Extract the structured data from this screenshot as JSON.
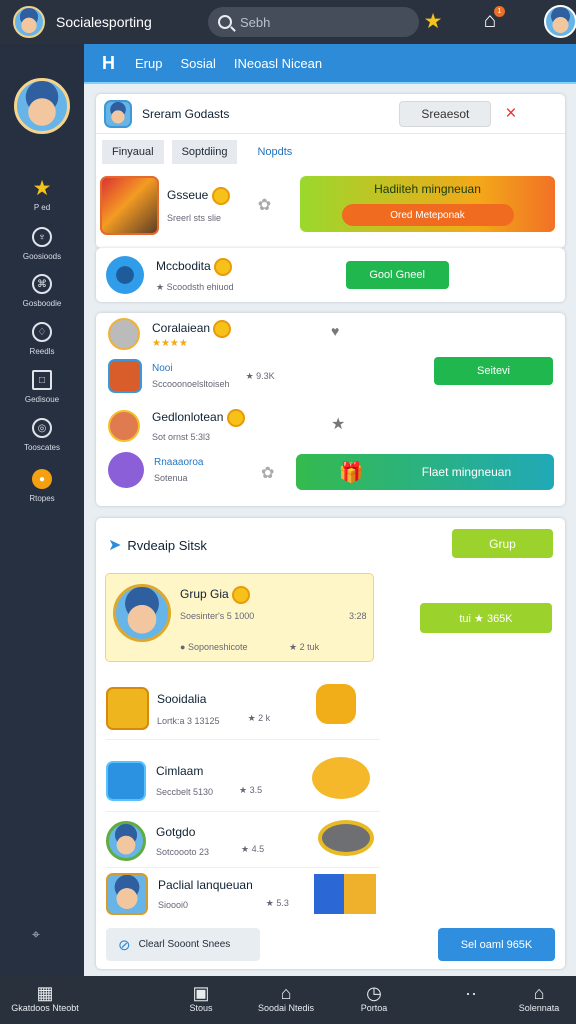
{
  "header": {
    "app_title": "Socialesporting",
    "search_placeholder": "Sebh",
    "star_icon": "star-icon",
    "notification_count": "1"
  },
  "tabs": {
    "logo": "H",
    "items": [
      "Erup",
      "Sosial",
      "INeoasl Nicean"
    ]
  },
  "sidebar": {
    "items": [
      {
        "label": "P ed",
        "icon": "star-icon"
      },
      {
        "label": "Goosioods",
        "icon": "trophy-icon"
      },
      {
        "label": "Gosboodie",
        "icon": "group-icon"
      },
      {
        "label": "Reedls",
        "icon": "shield-icon"
      },
      {
        "label": "Gedisoue",
        "icon": "calendar-icon"
      },
      {
        "label": "Tooscates",
        "icon": "target-icon"
      },
      {
        "label": "Rtopes",
        "icon": "fire-icon"
      }
    ]
  },
  "panel1": {
    "title": "Sreram Godasts",
    "search_button": "Sreaesot",
    "filters": [
      "Finyaual",
      "Soptdiing",
      "Nopdts"
    ],
    "item": {
      "name": "Gsseue",
      "subtitle": "Sreerl sts slie"
    },
    "banner_title": "Hadiiteh mingneuan",
    "banner_button": "Ored Meteponak"
  },
  "panel2": {
    "item": {
      "name": "Mccbodita",
      "subtitle": "Scoodsth ehiuod"
    },
    "button": "Gool Gneel"
  },
  "panel3": {
    "items": [
      {
        "name": "Coralaiean",
        "rating": "★★★★"
      },
      {
        "name": "Nooi",
        "subtitle": "Sccooonoelsltoiseh",
        "score": "9.3K"
      },
      {
        "name": "Gedlonlotean",
        "subtitle": "Sot ornst 5:3l3"
      },
      {
        "name": "Rnaaaoroa",
        "subtitle": "Sotenua"
      }
    ],
    "button": "Seitevi",
    "banner": "Flaet mingneuan"
  },
  "panel4": {
    "title": "Rvdeaip Sitsk",
    "top_button": "Grup",
    "featured": {
      "name": "Grup Gia",
      "subtitle": "Soesinter's 5 1000",
      "time": "3:28",
      "meta": "Soponeshicote",
      "score": "2 tuk"
    },
    "featured_button": "tui ★ 365K",
    "items": [
      {
        "name": "Sooidalia",
        "meta": "Lortk:a 3 13125",
        "score": "2 k"
      },
      {
        "name": "Cimlaam",
        "meta": "Seccbelt 5130",
        "score": "3.5"
      },
      {
        "name": "Gotgdo",
        "meta": "Sotcoooto 23",
        "score": "4.5"
      },
      {
        "name": "Paclial lanqueuan",
        "meta": "Sioooi0",
        "score": "5.3"
      }
    ],
    "bottom_left": "Clearl Sooont Snees",
    "bottom_right": "Sel oaml 965K"
  },
  "bottom_nav": [
    {
      "label": "Gkatdoos Nteobt",
      "icon": "dashboard-icon"
    },
    {
      "label": "Stous",
      "icon": "notification-icon"
    },
    {
      "label": "Soodai Ntedis",
      "icon": "home-icon"
    },
    {
      "label": "Portoa",
      "icon": "clock-icon"
    },
    {
      "label": "",
      "icon": "more-icon"
    },
    {
      "label": "Solennata",
      "icon": "profile-icon"
    }
  ]
}
